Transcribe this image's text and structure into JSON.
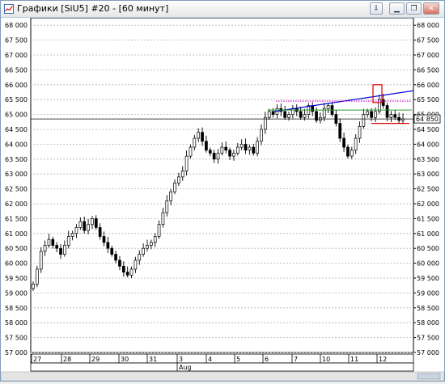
{
  "window": {
    "title": "Графики [SiU5] #20 - [60 минут]",
    "pin_icon": "pin-icon",
    "buttons": [
      "minimize-icon",
      "restore-icon",
      "maximize-icon",
      "close-icon"
    ]
  },
  "chart_data": {
    "type": "candlestick",
    "instrument": "SiU5",
    "timeframe": "60 минут",
    "ylim": [
      57000,
      68250
    ],
    "y_ticks": [
      "57 000",
      "57 500",
      "58 000",
      "58 500",
      "59 000",
      "59 500",
      "60 000",
      "60 500",
      "61 000",
      "61 500",
      "62 000",
      "62 500",
      "63 000",
      "63 500",
      "64 000",
      "64 500",
      "65 000",
      "65 500",
      "66 000",
      "66 500",
      "67 000",
      "67 500",
      "68 000"
    ],
    "y_tick_values": [
      57000,
      57500,
      58000,
      58500,
      59000,
      59500,
      60000,
      60500,
      61000,
      61500,
      62000,
      62500,
      63000,
      63500,
      64000,
      64500,
      65000,
      65500,
      66000,
      66500,
      67000,
      67500,
      68000
    ],
    "x_day_labels": [
      "27",
      "28",
      "29",
      "30",
      "31",
      "3",
      "4",
      "5",
      "6",
      "7",
      "10",
      "11",
      "12"
    ],
    "x_month_label": "Aug",
    "last_price_label": "64 850",
    "last_price": 64850,
    "grid": true,
    "close_path": [
      59300,
      59800,
      60400,
      60600,
      60800,
      60600,
      60500,
      60300,
      60600,
      60900,
      61000,
      61200,
      61400,
      61100,
      61300,
      61500,
      61200,
      60900,
      60700,
      60500,
      60300,
      60100,
      59900,
      59700,
      59600,
      59800,
      60100,
      60300,
      60500,
      60600,
      60700,
      60900,
      61300,
      61700,
      62100,
      62400,
      62700,
      62900,
      63100,
      63600,
      63900,
      64200,
      64400,
      64100,
      63800,
      63700,
      63500,
      63700,
      63900,
      63800,
      63600,
      63700,
      63900,
      64000,
      63800,
      63900,
      63700,
      64100,
      64500,
      64900,
      65100,
      65000,
      65200,
      65100,
      64900,
      65000,
      65200,
      65100,
      64900,
      65000,
      65300,
      65100,
      64800,
      64900,
      65200,
      65300,
      65000,
      64700,
      64200,
      63900,
      63600,
      63800,
      64200,
      64600,
      65000,
      65100,
      64900,
      65100,
      65500,
      65300,
      64900,
      65000,
      64900,
      64800,
      64850
    ],
    "annotations": {
      "resistance_line": [
        65100,
        65800
      ],
      "dotted_level": 65450,
      "green_level": 65150,
      "red_level": 64700,
      "highlight_box": [
        65400,
        66000
      ]
    }
  }
}
